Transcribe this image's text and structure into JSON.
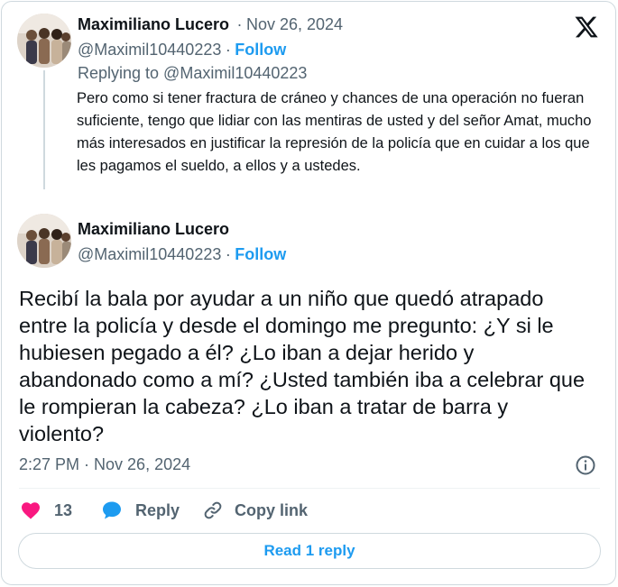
{
  "reply_tweet": {
    "author_name": "Maximiliano Lucero",
    "separator": "·",
    "date": "Nov 26, 2024",
    "handle": "@Maximil10440223",
    "follow_label": "Follow",
    "replying_to": "Replying to @Maximil10440223",
    "text": "Pero como si tener fractura de cráneo y chances de una operación no fueran suficiente, tengo que lidiar con las mentiras de usted y del señor Amat, mucho más interesados en justificar la represión de la policía que en cuidar a los que les pagamos el sueldo, a ellos y a ustedes."
  },
  "main_tweet": {
    "author_name": "Maximiliano Lucero",
    "handle": "@Maximil10440223",
    "separator": "·",
    "follow_label": "Follow",
    "text": "Recibí la bala por ayudar a un niño que quedó atrapado entre la policía y desde el domingo me pregunto: ¿Y si le hubiesen pegado a él? ¿Lo iban a dejar herido y abandonado como a mí? ¿Usted también iba a celebrar que le rompieran la cabeza? ¿Lo iban a tratar de barra y violento?",
    "timestamp": "2:27 PM · Nov 26, 2024"
  },
  "actions": {
    "like_count": "13",
    "reply_label": "Reply",
    "copy_link_label": "Copy link"
  },
  "read_reply_label": "Read 1 reply",
  "icons": {
    "logo": "x-logo-icon",
    "like": "heart-icon",
    "reply": "speech-bubble-icon",
    "copy": "link-icon",
    "info": "info-icon"
  },
  "colors": {
    "accent": "#1d9bf0",
    "like": "#f91880",
    "muted": "#536471",
    "text": "#0f1419",
    "border": "#cfd9de"
  }
}
